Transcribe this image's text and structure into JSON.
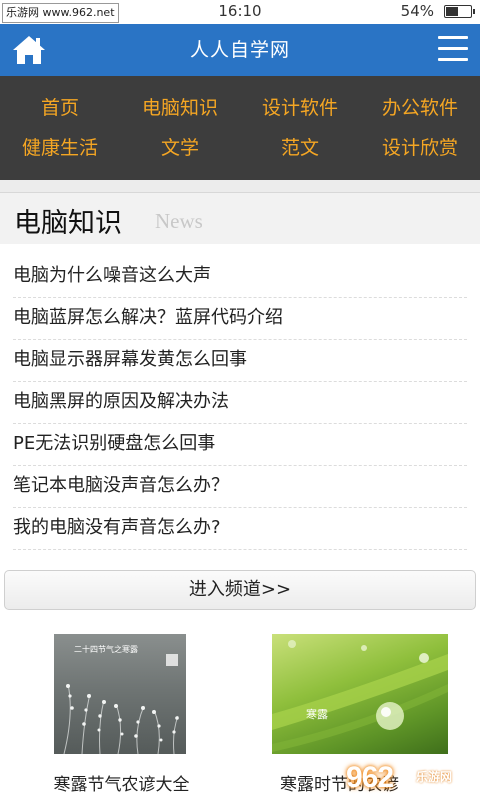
{
  "status_bar": {
    "left_badge": "乐游网 www.962.net",
    "time": "16:10",
    "battery_pct": "54%",
    "battery_level": 0.54
  },
  "header": {
    "title": "人人自学网",
    "color": "#2a74c5"
  },
  "nav": {
    "rows": [
      [
        "首页",
        "电脑知识",
        "设计软件",
        "办公软件"
      ],
      [
        "健康生活",
        "文学",
        "范文",
        "设计欣赏"
      ]
    ],
    "text_color": "#f5a623",
    "bg_color": "#3d3d3d"
  },
  "section": {
    "title": "电脑知识",
    "subtitle": "News"
  },
  "articles": [
    "电脑为什么噪音这么大声",
    "电脑蓝屏怎么解决？蓝屏代码介绍",
    "电脑显示器屏幕发黄怎么回事",
    "电脑黑屏的原因及解决办法",
    "PE无法识别硬盘怎么回事",
    "笔记本电脑没声音怎么办？",
    "我的电脑没有声音怎么办?"
  ],
  "enter_button": "进入频道>>",
  "thumbnails": [
    {
      "caption": "寒露节气农谚大全",
      "image_text": "二十四节气之寒露"
    },
    {
      "caption": "寒露时节的农谚",
      "image_text": "寒露"
    }
  ],
  "watermark": {
    "main": "962",
    "sub": "乐游网"
  }
}
